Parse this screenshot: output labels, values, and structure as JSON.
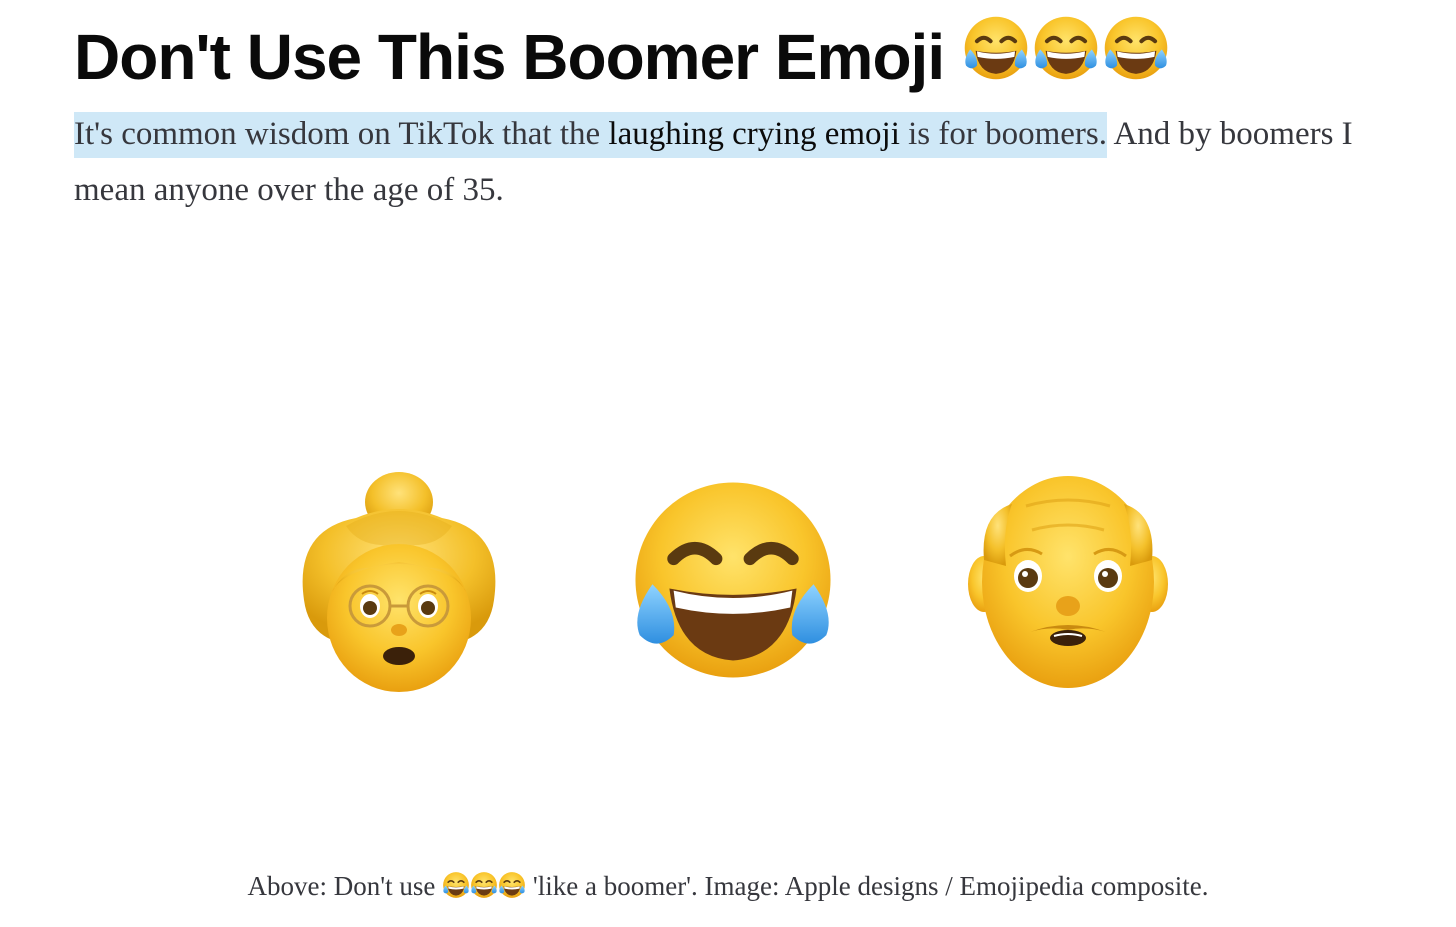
{
  "article": {
    "title": "Don't Use This Boomer Emoji",
    "title_emoji_icons": [
      "face-with-tears-of-joy-icon",
      "face-with-tears-of-joy-icon",
      "face-with-tears-of-joy-icon"
    ],
    "intro": {
      "part1": "It's common wisdom on TikTok that the ",
      "link_text": "laughing crying emoji",
      "part2": " is for boomers.",
      "part3": " And by boomers I mean anyone over the age of 35."
    },
    "figure": {
      "images": [
        "older-woman-emoji",
        "face-with-tears-of-joy-emoji",
        "older-man-emoji"
      ]
    },
    "caption": {
      "before": "Above: Don't use ",
      "after": " 'like a boomer'. Image: Apple designs / Emojipedia composite."
    }
  },
  "colors": {
    "highlight": "#cfe8f7",
    "text": "#36373d",
    "title": "#0a0a0a",
    "emoji_yellow": "#f7c425",
    "tear_blue": "#3fa0e8"
  }
}
